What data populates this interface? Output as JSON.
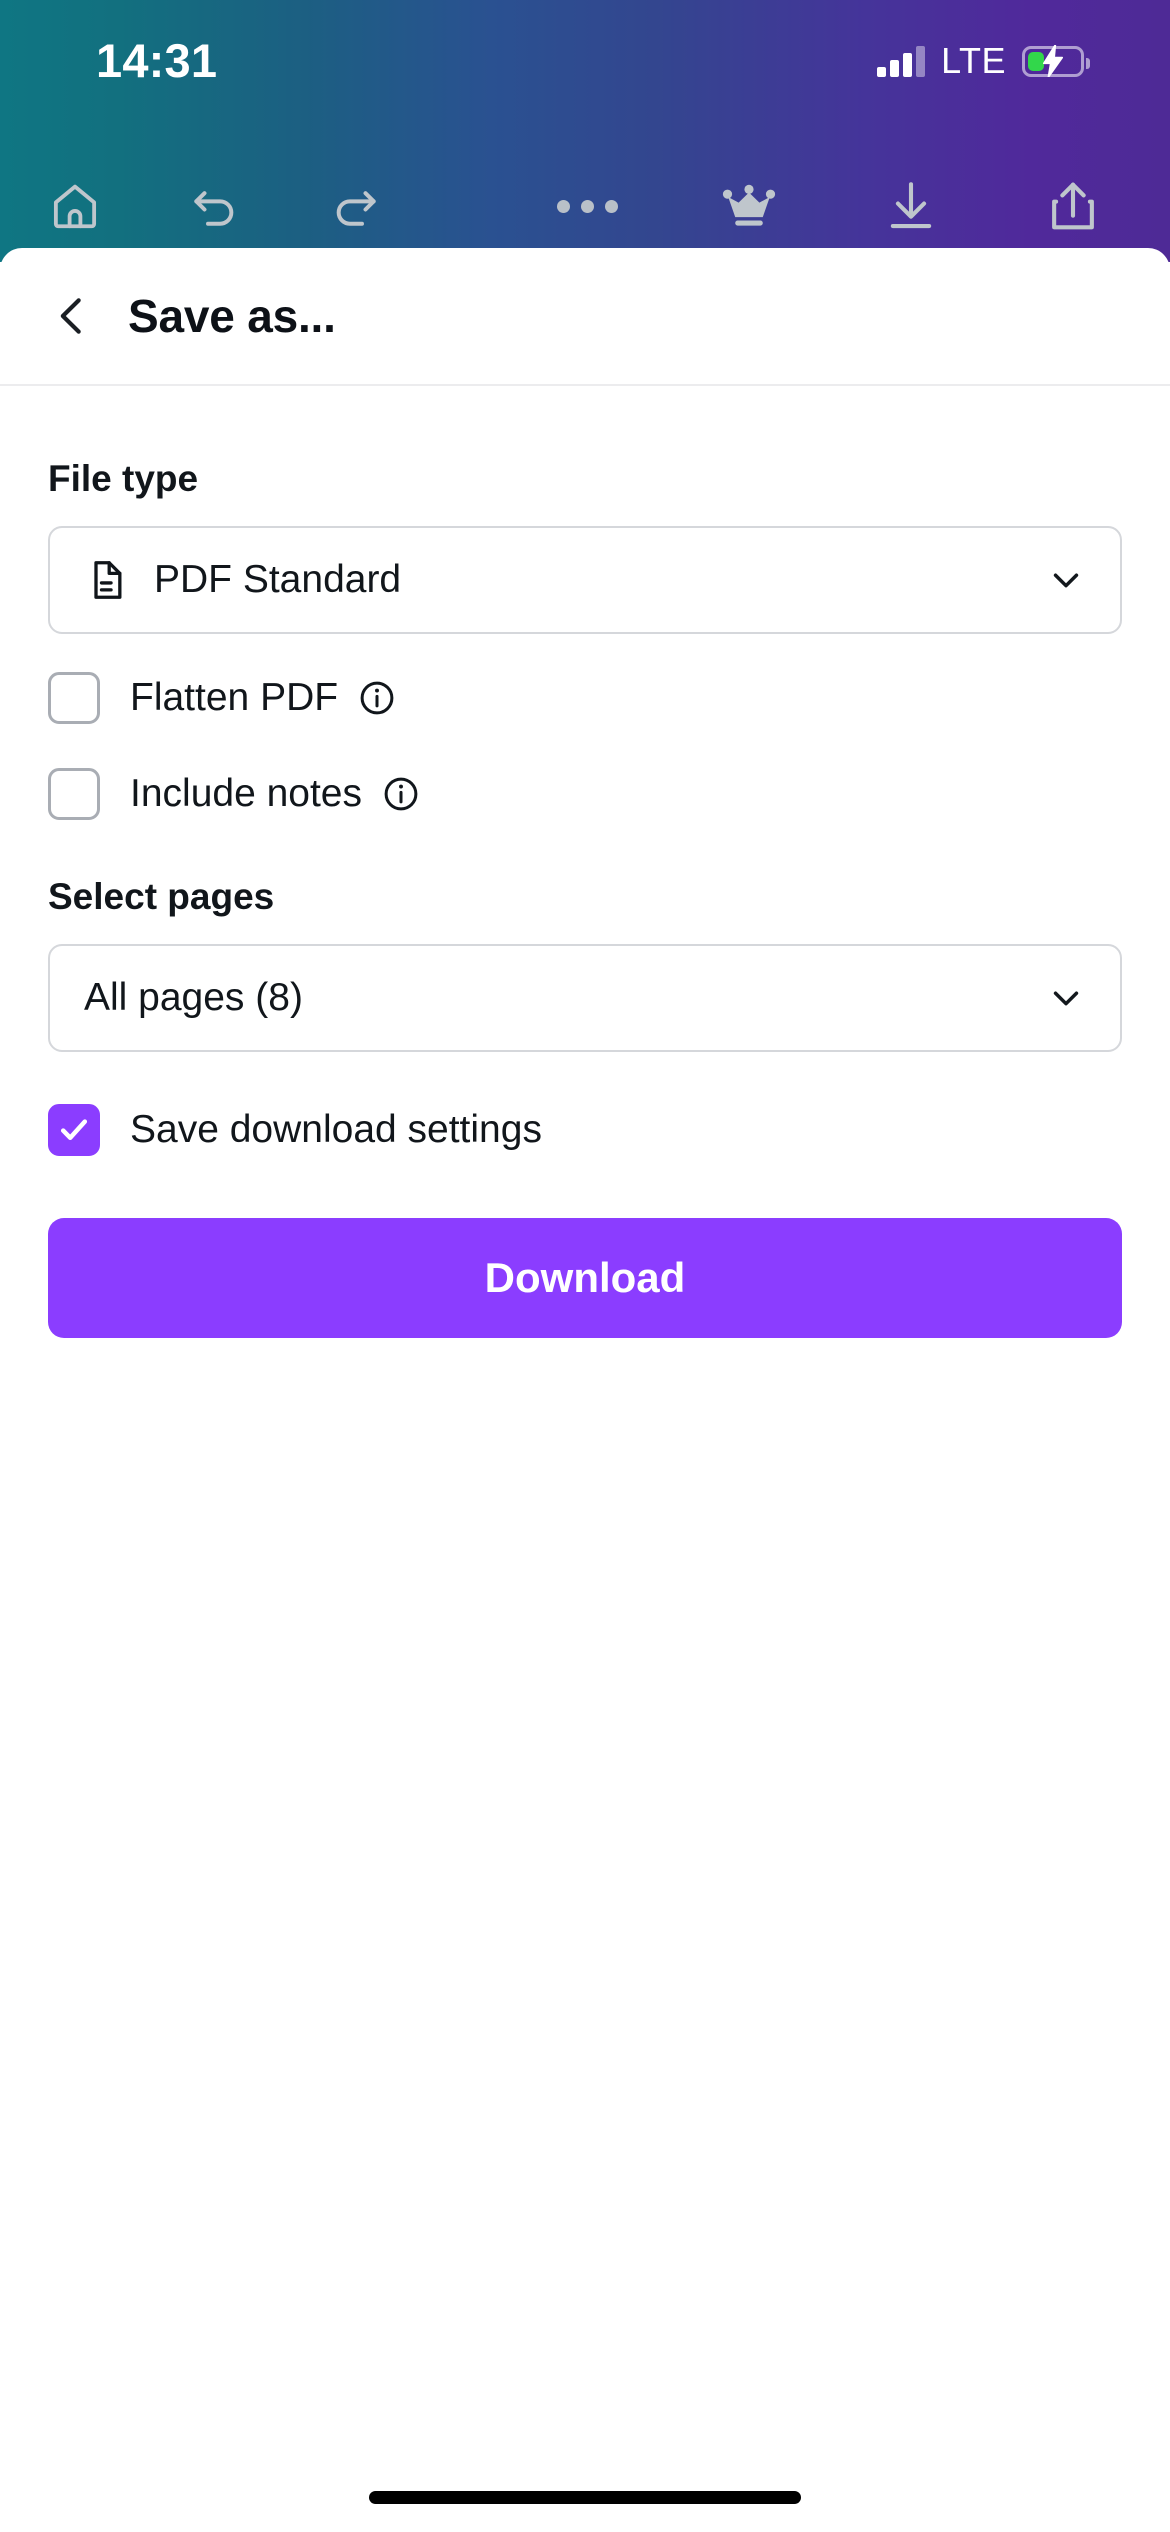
{
  "status_bar": {
    "time": "14:31",
    "network_label": "LTE",
    "signal_icon": "signal-bars-icon",
    "signal_bars_filled": 3,
    "signal_bars_total": 4,
    "battery_icon": "battery-charging-icon",
    "battery_level_percent": 32,
    "battery_charging": true
  },
  "editor_toolbar": {
    "left_items": [
      {
        "name": "home-icon",
        "label": "Home"
      },
      {
        "name": "undo-icon",
        "label": "Undo"
      },
      {
        "name": "redo-icon",
        "label": "Redo"
      }
    ],
    "right_items": [
      {
        "name": "more-options-icon",
        "label": "More options"
      },
      {
        "name": "crown-icon",
        "label": "Pro"
      },
      {
        "name": "download-icon",
        "label": "Download"
      },
      {
        "name": "share-icon",
        "label": "Share"
      }
    ]
  },
  "header": {
    "back_icon": "chevron-left-icon",
    "title": "Save as..."
  },
  "file_type": {
    "label": "File type",
    "icon": "document-file-icon",
    "selected": "PDF Standard",
    "chevron_icon": "chevron-down-icon"
  },
  "options": [
    {
      "label": "Flatten PDF",
      "checked": false,
      "info_icon": "info-circle-icon"
    },
    {
      "label": "Include notes",
      "checked": false,
      "info_icon": "info-circle-icon"
    }
  ],
  "select_pages": {
    "label": "Select pages",
    "selected": "All pages (8)",
    "page_count": 8,
    "chevron_icon": "chevron-down-icon"
  },
  "save_settings": {
    "label": "Save download settings",
    "checked": true,
    "check_icon": "checkmark-icon"
  },
  "primary_action": {
    "label": "Download"
  },
  "colors": {
    "accent_purple": "#8B3DFF",
    "chrome_gradient_start": "#0F7683",
    "chrome_gradient_mid": "#2C5091",
    "chrome_gradient_end": "#4E2A96",
    "battery_green": "#32D74B",
    "text_primary": "#11161B",
    "border_gray": "#D5D7DB"
  }
}
